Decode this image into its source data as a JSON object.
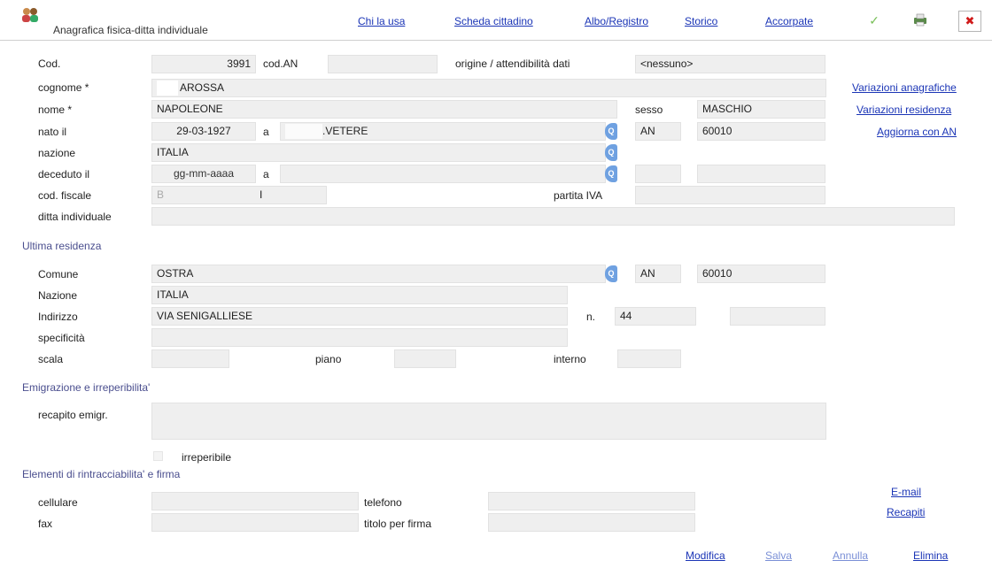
{
  "header": {
    "title": "Anagrafica fisica-ditta individuale",
    "tabs": [
      "Chi la usa",
      "Scheda cittadino",
      "Albo/Registro",
      "Storico",
      "Accorpate"
    ],
    "icons": {
      "app": "people-icon",
      "confirm": "checkmark-icon",
      "print": "printer-icon",
      "close": "close-icon"
    },
    "check_glyph": "✓",
    "close_glyph": "✖"
  },
  "side_links": [
    "Variazioni anagrafiche",
    "Variazioni residenza",
    "Aggiorna con AN"
  ],
  "person": {
    "cod_label": "Cod.",
    "cod_value": "3991",
    "cod_an_label": "cod.AN",
    "cod_an_value": "",
    "origine_label": "origine / attendibilità dati",
    "origine_value": "<nessuno>",
    "cognome_label": "cognome *",
    "cognome_value": "AROSSA",
    "nome_label": "nome *",
    "nome_value": "NAPOLEONE",
    "sesso_label": "sesso",
    "sesso_value": "MASCHIO",
    "nato_label": "nato il",
    "nato_date": "29-03-1927",
    "nato_a_label": "a",
    "nato_place": ".VETERE",
    "nato_prov": "AN",
    "nato_cap": "60010",
    "nazione_label": "nazione",
    "nazione_value": "ITALIA",
    "deceduto_label": "deceduto il",
    "deceduto_placeholder": "gg-mm-aaaa",
    "deceduto_a_label": "a",
    "cf_label": "cod. fiscale",
    "cf_value": "B",
    "cf_suffix": "I",
    "piva_label": "partita IVA",
    "ditta_label": "ditta individuale"
  },
  "residenza": {
    "section_title": "Ultima residenza",
    "comune_label": "Comune",
    "comune_value": "OSTRA",
    "comune_prov": "AN",
    "comune_cap": "60010",
    "nazione_label": "Nazione",
    "nazione_value": "ITALIA",
    "indirizzo_label": "Indirizzo",
    "indirizzo_value": "VIA SENIGALLIESE",
    "num_label": "n.",
    "num_value": "44",
    "specificita_label": "specificità",
    "scala_label": "scala",
    "piano_label": "piano",
    "interno_label": "interno"
  },
  "emigrazione": {
    "section_title": "Emigrazione e irreperibilita'",
    "recapito_label": "recapito emigr.",
    "irreperibile_label": "irreperibile"
  },
  "contatti": {
    "section_title": "Elementi di rintracciabilita' e firma",
    "cellulare_label": "cellulare",
    "telefono_label": "telefono",
    "fax_label": "fax",
    "titolo_label": "titolo per firma",
    "email_link": "E-mail",
    "recapiti_link": "Recapiti"
  },
  "actions": [
    "Modifica",
    "Salva",
    "Annulla",
    "Elimina"
  ],
  "search_glyph": "Q",
  "colors": {
    "section": "#4a4e8e",
    "link": "#1b35b6",
    "link_disabled": "#7a8fd6",
    "search": "#6fa1e1",
    "field": "#efefef"
  }
}
